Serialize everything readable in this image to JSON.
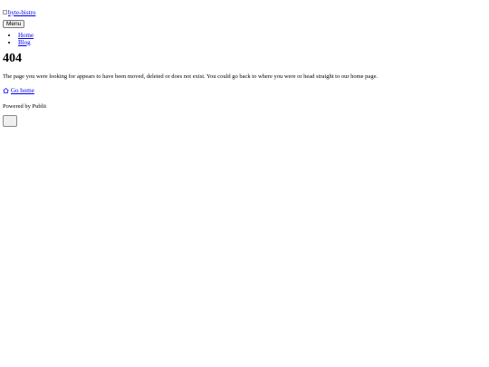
{
  "header": {
    "logo_alt": "byte-bistro",
    "menu_label": "Menu"
  },
  "nav": {
    "items": [
      {
        "label": "Home"
      },
      {
        "label": "Blog"
      }
    ]
  },
  "main": {
    "error_code": "404",
    "message": "The page you were looking for appears to have been moved, deleted or does not exist. You could go back to where you were or head straight to our home page.",
    "go_home_label": "Go home"
  },
  "footer": {
    "powered_by": "Powered by Publii"
  },
  "icons": {
    "logo": "broken-image-icon",
    "go_home": "home-icon",
    "back_to_top": "back-to-top-button"
  }
}
